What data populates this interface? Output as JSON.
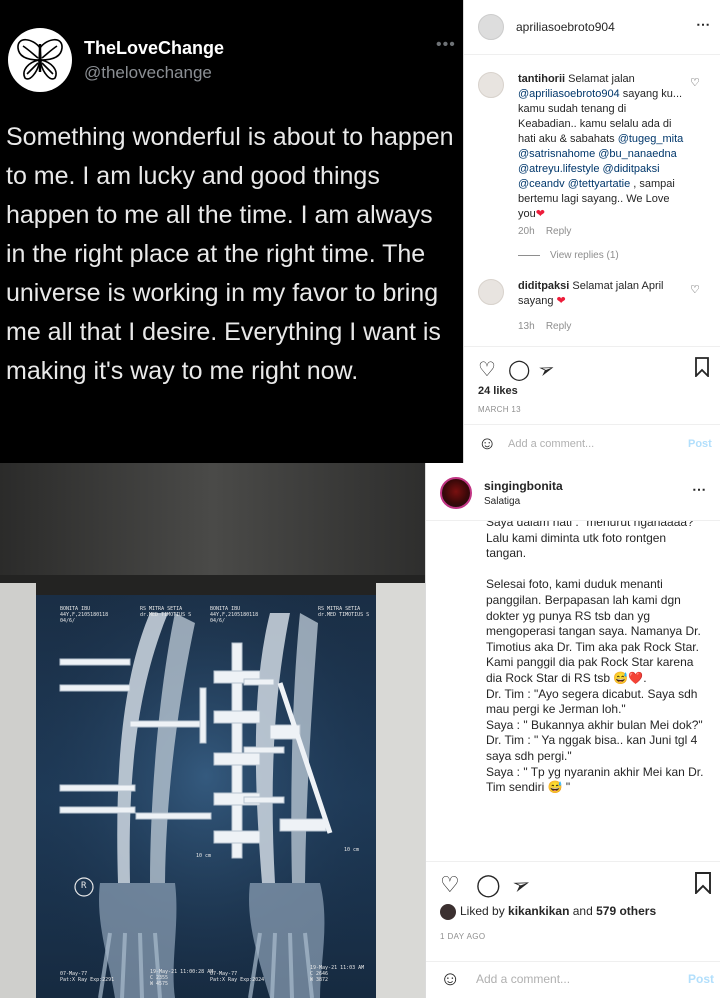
{
  "tweet": {
    "name": "TheLoveChange",
    "handle": "@thelovechange",
    "more_icon": "ellipsis-icon",
    "body": "Something wonderful is about to happen to me. I am lucky and good things happen to me all the time. I am always in the right place at the right time. The universe is working in my favor to bring me all that I desire. Everything I want is making it's way to me right now."
  },
  "post1": {
    "username": "apriliasoebroto904",
    "comments": [
      {
        "user": "tantihorii",
        "text_1": " Selamat jalan ",
        "mention_1": "@apriliasoebroto904",
        "text_2": " sayang ku... kamu sudah tenang di Keabadian.. kamu selalu ada di hati aku & sabahats ",
        "mentions_2": "@tugeg_mita @satrisnahome @bu_nanaedna @atreyu.lifestyle @diditpaksi @ceandv @tettyartatie",
        "text_3": " , sampai bertemu lagi sayang.. We Love you",
        "emoji": "❤",
        "time": "20h",
        "reply": "Reply"
      },
      {
        "user": "diditpaksi",
        "text_1": " Selamat jalan April sayang ",
        "emoji": "❤",
        "time": "13h",
        "reply": "Reply"
      }
    ],
    "view_replies": "View replies (1)",
    "likes": "24 likes",
    "date": "MARCH 13",
    "add_comment_placeholder": "Add a comment...",
    "post_label": "Post"
  },
  "xray": {
    "labels": [
      "BONITA IBU\n44Y,F,2105180118\n04/6/",
      "RS MITRA SETIA\ndr.MED TIMOTIUS S",
      "BONITA IBU\n44Y,F,2105180118\n04/6/",
      "RS MITRA SETIA\ndr.MED TIMOTIUS S"
    ],
    "scale_labels": [
      "10 cm",
      "10 cm"
    ],
    "marker": "R",
    "footer": [
      "07-May-77\nPat:X Ray Exp:2291",
      "19-May-21 11:00:28 AM\nC 2355\nW 4575",
      "07-May-77\nPat:X Ray Exp:2024",
      "19-May-21 11:03 AM\nC 2646\nW 3872"
    ]
  },
  "post2": {
    "username": "singingbonita",
    "location": "Salatiga",
    "caption": "Saya dalam hati : \"menurut nganaaaa?\"\nLalu kami diminta utk foto rontgen tangan.\n\nSelesai foto, kami duduk menanti panggilan. Berpapasan lah kami dgn dokter yg punya RS tsb dan yg mengoperasi tangan saya. Namanya Dr. Timotius aka Dr. Tim aka pak Rock Star. Kami panggil dia pak Rock Star karena dia Rock Star di RS tsb 😅❤️.\nDr. Tim : \"Ayo segera dicabut. Saya sdh mau pergi ke Jerman loh.\"\nSaya : \" Bukannya akhir bulan Mei dok?\"\nDr. Tim : \" Ya nggak bisa.. kan Juni tgl 4 saya sdh pergi.\"\nSaya : \" Tp yg nyaranin akhir Mei kan Dr. Tim sendiri 😅 \"",
    "liked_by_prefix": "Liked by ",
    "liked_by_user": "kikankikan",
    "liked_by_and": " and ",
    "liked_by_others": "579 others",
    "ago": "1 DAY AGO",
    "add_comment_placeholder": "Add a comment...",
    "post_label": "Post"
  }
}
